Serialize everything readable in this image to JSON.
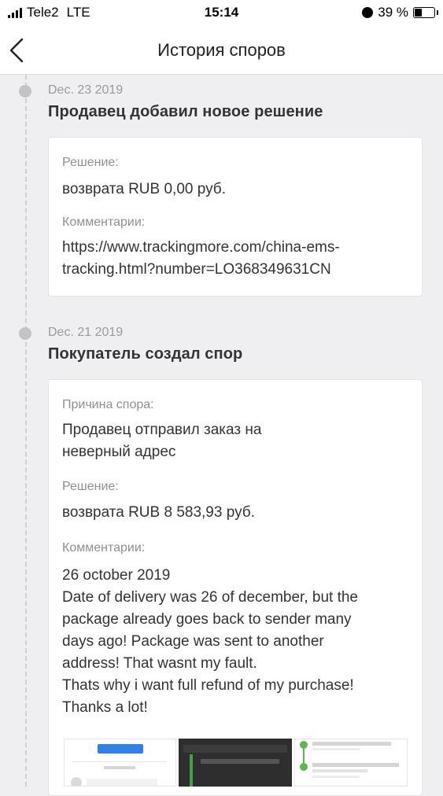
{
  "status_bar": {
    "carrier": "Tele2",
    "network": "LTE",
    "time": "15:14",
    "battery": "39 %",
    "battery_level": 0.39
  },
  "header": {
    "title": "История споров"
  },
  "events": [
    {
      "date": "Dec. 23 2019",
      "title": "Продавец добавил новое решение",
      "fields": [
        {
          "label": "Решение:",
          "value": "возврата RUB 0,00 руб."
        },
        {
          "label": "Комментарии:",
          "value": "https://www.trackingmore.com/china-ems-\ntracking.html?number=LO368349631CN"
        }
      ]
    },
    {
      "date": "Dec. 21 2019",
      "title": "Покупатель создал спор",
      "fields": [
        {
          "label": "Причина спора:",
          "value": "Продавец отправил заказ на\nневерный адрес"
        },
        {
          "label": "Решение:",
          "value": "возврата RUB 8 583,93 руб."
        },
        {
          "label": "Комментарии:",
          "value": "26 october 2019\nDate of delivery was 26 of december, but the\npackage already goes back to sender many\ndays ago! Package was sent to another\naddress! That wasnt my fault.\nThats why i want full refund of my purchase!\nThanks a lot!"
        }
      ]
    }
  ],
  "attachments": [
    "attachment-photo-1",
    "attachment-photo-2",
    "attachment-photo-3"
  ]
}
